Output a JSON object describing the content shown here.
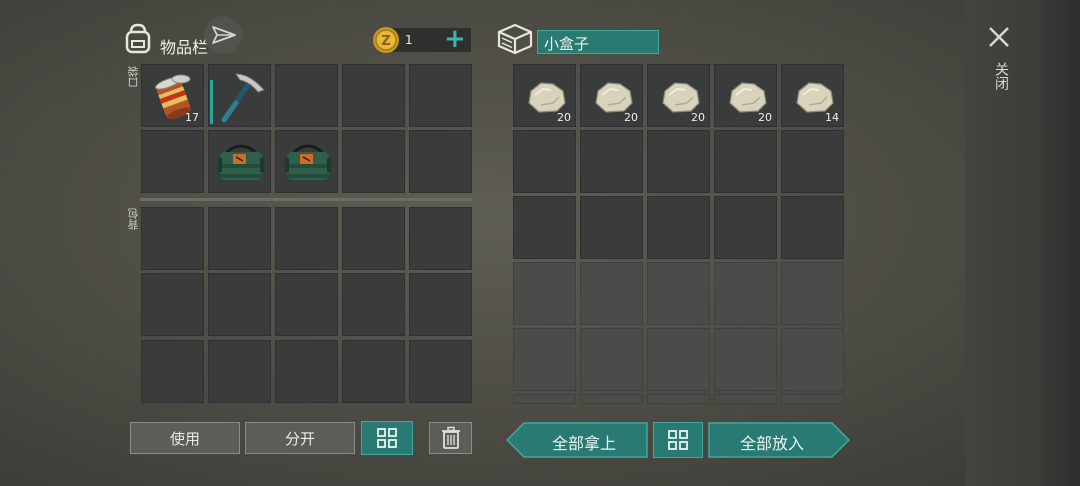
{
  "inventory": {
    "title": "物品栏",
    "pocket_label": "口袋",
    "backpack_label": "背包",
    "pocket_slots": [
      {
        "item": "canned-food-icon",
        "count": "17"
      },
      {
        "item": "pickaxe-icon",
        "count": ""
      },
      {
        "item": "",
        "count": ""
      },
      {
        "item": "",
        "count": ""
      },
      {
        "item": "",
        "count": ""
      },
      {
        "item": "",
        "count": ""
      },
      {
        "item": "supply-bag-icon",
        "count": ""
      },
      {
        "item": "supply-bag-icon",
        "count": ""
      },
      {
        "item": "",
        "count": ""
      },
      {
        "item": "",
        "count": ""
      }
    ]
  },
  "currency": {
    "amount": "1",
    "add_label": "+"
  },
  "container": {
    "name": "小盒子",
    "slots": [
      {
        "item": "stone-icon",
        "count": "20"
      },
      {
        "item": "stone-icon",
        "count": "20"
      },
      {
        "item": "stone-icon",
        "count": "20"
      },
      {
        "item": "stone-icon",
        "count": "20"
      },
      {
        "item": "stone-icon",
        "count": "14"
      }
    ]
  },
  "buttons": {
    "use": "使用",
    "split": "分开",
    "take_all": "全部拿上",
    "put_all": "全部放入",
    "close": "关闭"
  },
  "colors": {
    "accent": "#2a7a74",
    "accent_border": "#3fa9a0"
  }
}
